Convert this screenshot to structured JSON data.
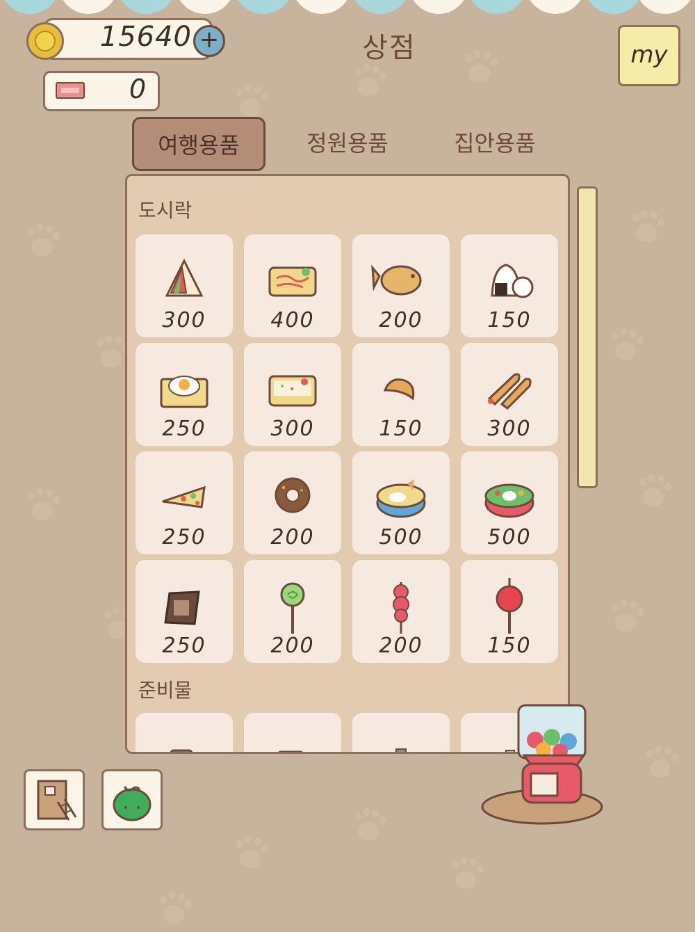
{
  "header": {
    "title": "상점",
    "coins": "15640",
    "tickets": "0",
    "plus_icon": "+",
    "my_label": "my"
  },
  "tabs": [
    {
      "label": "여행용품",
      "active": true
    },
    {
      "label": "정원용품",
      "active": false
    },
    {
      "label": "집안용품",
      "active": false
    }
  ],
  "sections": [
    {
      "label": "도시락",
      "items": [
        {
          "name": "sandwich",
          "icon": "sandwich-icon",
          "price": "300"
        },
        {
          "name": "omurice-box",
          "icon": "omurice-icon",
          "price": "400"
        },
        {
          "name": "taiyaki",
          "icon": "taiyaki-icon",
          "price": "200"
        },
        {
          "name": "onigiri",
          "icon": "onigiri-icon",
          "price": "150"
        },
        {
          "name": "fried-egg-toast",
          "icon": "egg-toast-icon",
          "price": "250"
        },
        {
          "name": "rice-box",
          "icon": "rice-box-icon",
          "price": "300"
        },
        {
          "name": "croissant",
          "icon": "croissant-icon",
          "price": "150"
        },
        {
          "name": "fried-shrimp",
          "icon": "shrimp-icon",
          "price": "300"
        },
        {
          "name": "pizza",
          "icon": "pizza-icon",
          "price": "250"
        },
        {
          "name": "donut",
          "icon": "donut-icon",
          "price": "200"
        },
        {
          "name": "blue-bento",
          "icon": "blue-bento-icon",
          "price": "500"
        },
        {
          "name": "red-bento",
          "icon": "red-bento-icon",
          "price": "500"
        },
        {
          "name": "chocolate",
          "icon": "chocolate-icon",
          "price": "250"
        },
        {
          "name": "lollipop",
          "icon": "lollipop-icon",
          "price": "200"
        },
        {
          "name": "strawberry-skewer",
          "icon": "strawberry-skewer-icon",
          "price": "200"
        },
        {
          "name": "candy-apple",
          "icon": "candy-apple-icon",
          "price": "150"
        }
      ]
    },
    {
      "label": "준비물",
      "items": [
        {
          "name": "mug",
          "icon": "mug-icon",
          "price": ""
        },
        {
          "name": "red-cup",
          "icon": "red-cup-icon",
          "price": ""
        },
        {
          "name": "bottle",
          "icon": "bottle-icon",
          "price": ""
        },
        {
          "name": "jar",
          "icon": "jar-icon",
          "price": ""
        }
      ]
    }
  ],
  "colors": {
    "background": "#c8b39c",
    "panel": "#e2cbb1",
    "card": "#f6e9e0",
    "active_tab": "#b48d78",
    "coin": "#e6bd3f",
    "plus": "#7ab0c9",
    "my_button": "#f6ecaa",
    "awning_blue": "#a9d8dc",
    "awning_cream": "#fbf5e9"
  },
  "bottom_buttons": [
    {
      "name": "house-button",
      "icon": "house-ladder-icon"
    },
    {
      "name": "bag-button",
      "icon": "green-bag-icon"
    }
  ],
  "gacha": {
    "icon": "gacha-machine-icon"
  }
}
